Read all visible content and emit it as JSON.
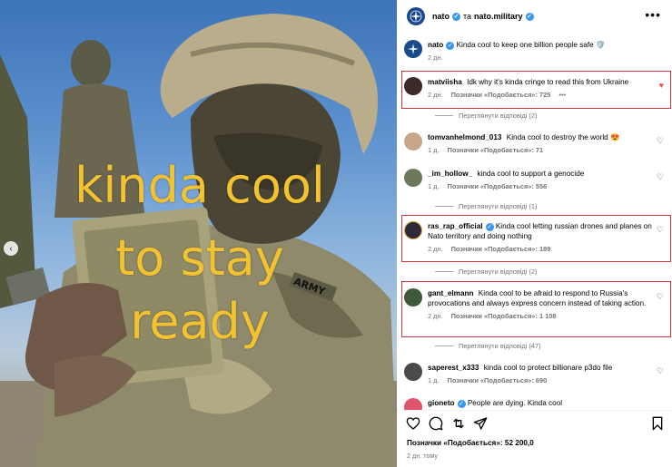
{
  "photo": {
    "overlay_lines": [
      "kinda cool",
      "to stay",
      "ready"
    ],
    "patch_text": "ARMY",
    "prev_arrow": "‹"
  },
  "header": {
    "account": "nato",
    "connector": "та",
    "collaborator": "nato.military",
    "more": "•••"
  },
  "caption": {
    "user": "nato",
    "text": "Kinda cool to keep one billion people safe",
    "emoji": "🛡️",
    "time": "2 дн."
  },
  "comments": [
    {
      "user": "matviisha",
      "text": "Idk why it's kinda cringe to read this from Ukraine",
      "time": "2 дн.",
      "likes": "Позначки «Подобається»: 725",
      "more": "•••",
      "liked": true,
      "replies": "Переглянути відповіді (2)"
    },
    {
      "user": "tomvanhelmond_013",
      "text": "Kinda cool to destroy the world 😍",
      "time": "1 д.",
      "likes": "Позначки «Подобається»: 71",
      "liked": false
    },
    {
      "user": "_im_hollow_",
      "text": "kinda cool to support a genocide",
      "time": "1 д.",
      "likes": "Позначки «Подобається»: 556",
      "liked": false,
      "replies": "Переглянути відповіді (1)"
    },
    {
      "user": "ras_rap_official",
      "text": "Kinda cool letting russian drones and planes on Nato territory and doing nothing",
      "time": "2 дн.",
      "likes": "Позначки «Подобається»: 189",
      "liked": false,
      "replies": "Переглянути відповіді (2)"
    },
    {
      "user": "gant_elmann",
      "text": "Kinda cool to be afraid to respond to Russia's provocations and always express concern instead of taking action.",
      "time": "2 дн.",
      "likes": "Позначки «Подобається»: 1 108",
      "liked": false,
      "replies": "Переглянути відповіді (47)"
    },
    {
      "user": "saperest_x333",
      "text": "kinda cool to protect billionare p3do file",
      "time": "1 д.",
      "likes": "Позначки «Подобається»: 690",
      "liked": false
    },
    {
      "user": "gioneto",
      "text": "People are dying. Kinda cool",
      "liked": false
    }
  ],
  "footer": {
    "likes": "Позначки «Подобається»: 52 200,0",
    "date": "2 дн. тому"
  },
  "colors": {
    "overlay_text": "#f2c230",
    "highlight_border": "#d9363e",
    "liked_heart": "#ed4956",
    "verified": "#3897f0",
    "nato_blue": "#1a4a8c"
  },
  "icons": [
    "heart-icon",
    "comment-icon",
    "share-icon",
    "send-icon",
    "bookmark-icon",
    "verified-icon",
    "more-icon",
    "chevron-left-icon"
  ]
}
